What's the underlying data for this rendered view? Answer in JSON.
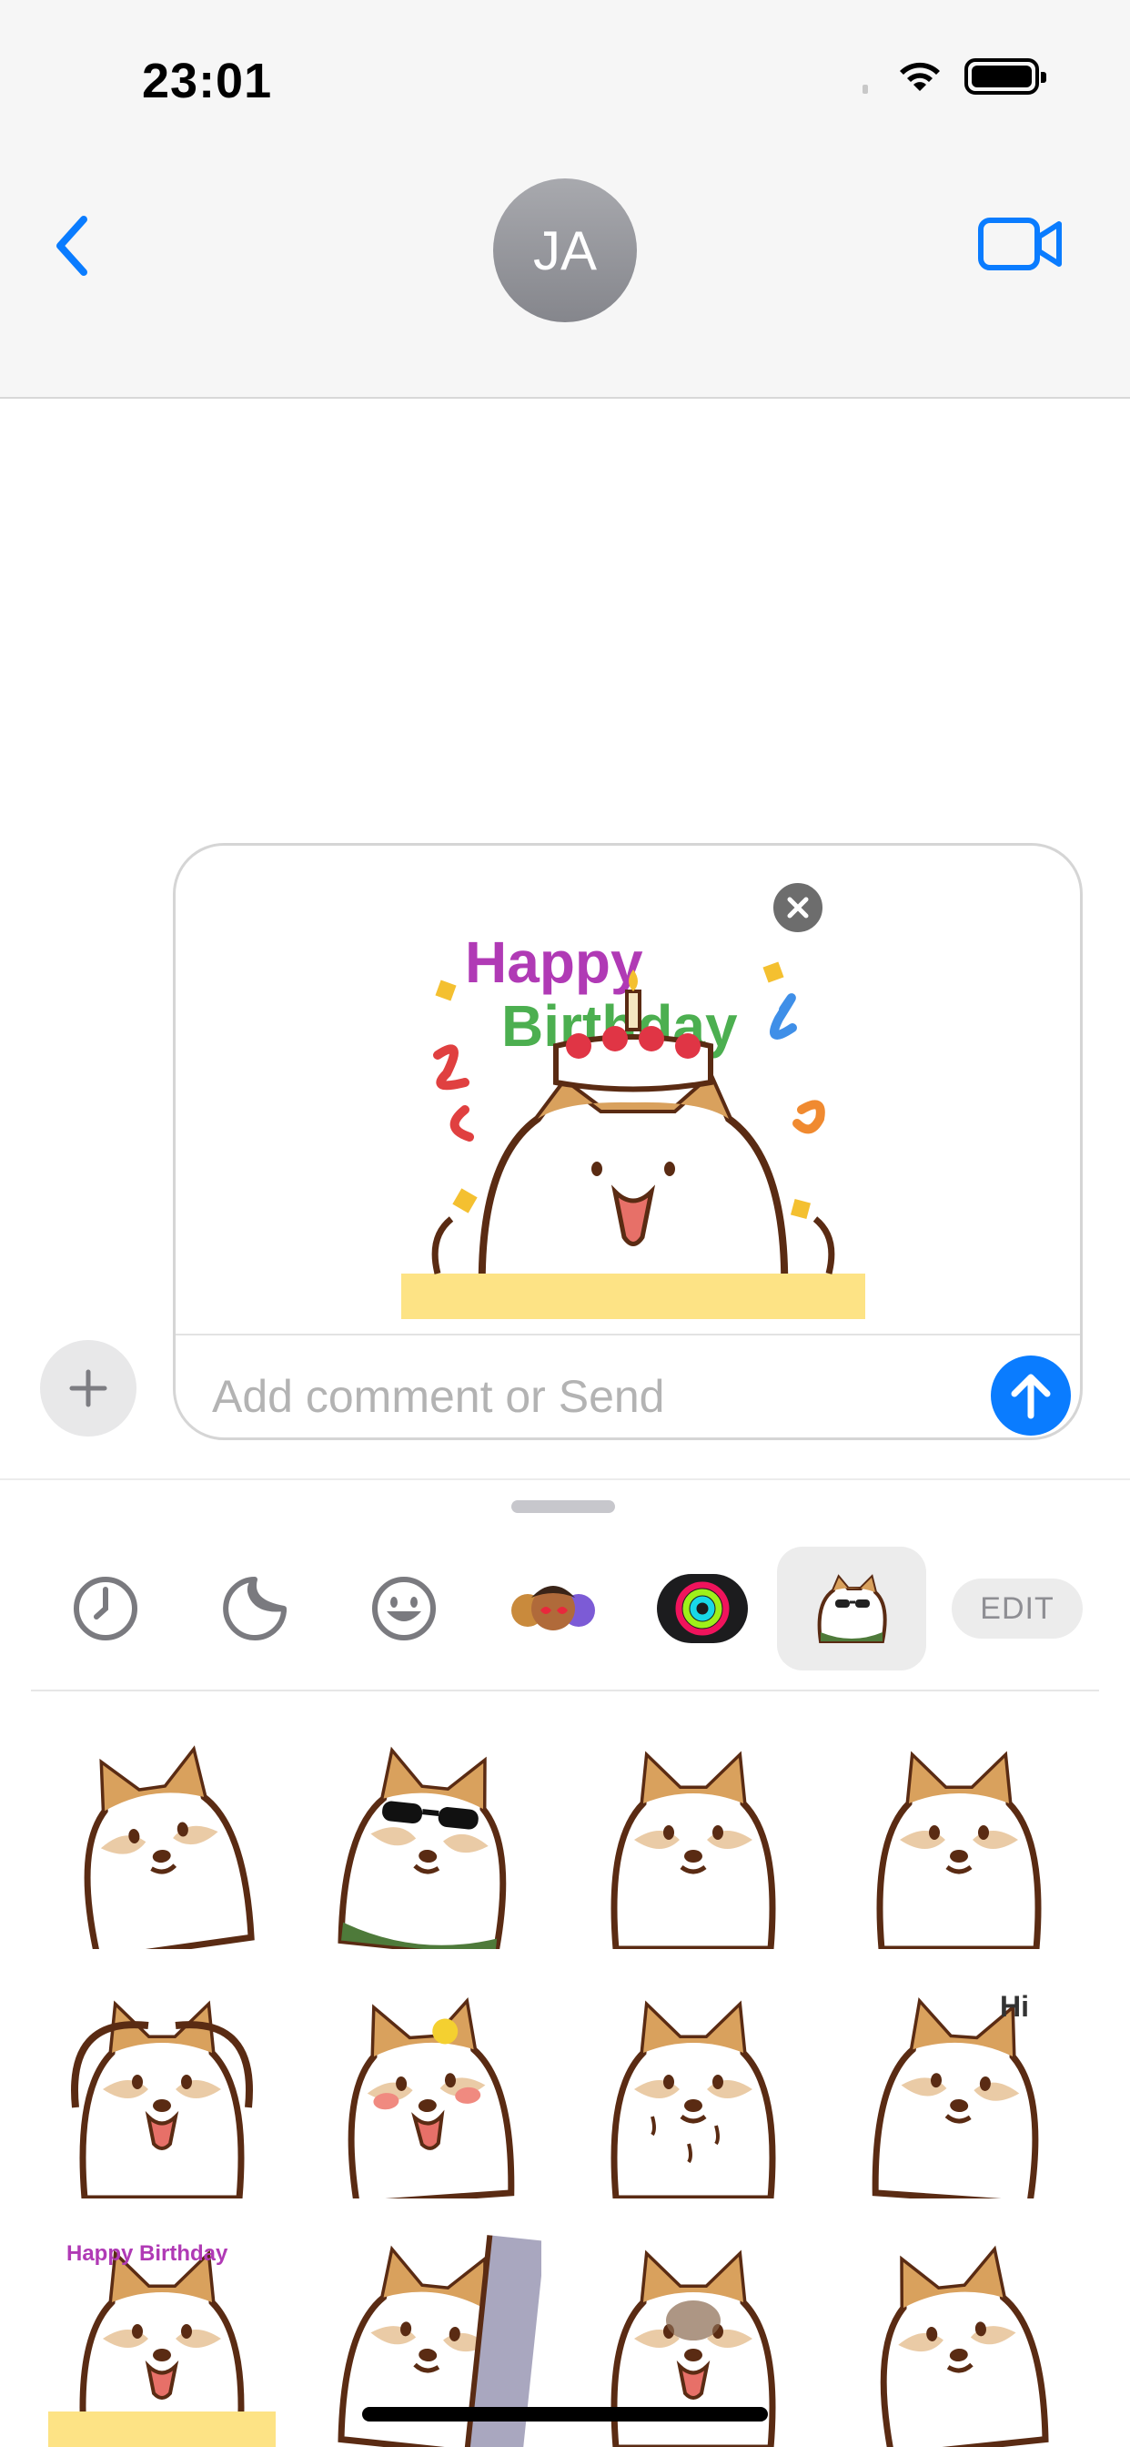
{
  "status_bar": {
    "time": "23:01"
  },
  "conversation": {
    "contact_initials": "JA"
  },
  "compose": {
    "placeholder": "Add comment or Send",
    "attached_sticker_text": [
      "Happy",
      "Birthday"
    ]
  },
  "drawer": {
    "apps": [
      "recents-icon",
      "stickers-icon",
      "emoji-icon",
      "memoji-icon",
      "activity-icon",
      "shiba-sticker-pack-icon"
    ],
    "edit_label": "EDIT",
    "stickers": [
      {
        "name": "shiba-burst-sticker"
      },
      {
        "name": "shiba-sunglasses-sticker"
      },
      {
        "name": "shiba-chubby-sparkle-sticker"
      },
      {
        "name": "shiba-crossed-arms-sticker"
      },
      {
        "name": "shiba-heart-arms-sticker"
      },
      {
        "name": "shiba-flower-blush-sticker"
      },
      {
        "name": "shiba-sweating-sticker"
      },
      {
        "name": "shiba-hi-sticker",
        "text": "Hi"
      },
      {
        "name": "shiba-birthday-sticker",
        "text": "Happy Birthday"
      },
      {
        "name": "shiba-door-peek-sticker"
      },
      {
        "name": "shiba-angry-sticker"
      },
      {
        "name": "shiba-worried-sticker"
      }
    ]
  },
  "colors": {
    "accent": "#0a7cff",
    "shiba": "#d9a15d",
    "outline": "#5a2b13"
  }
}
